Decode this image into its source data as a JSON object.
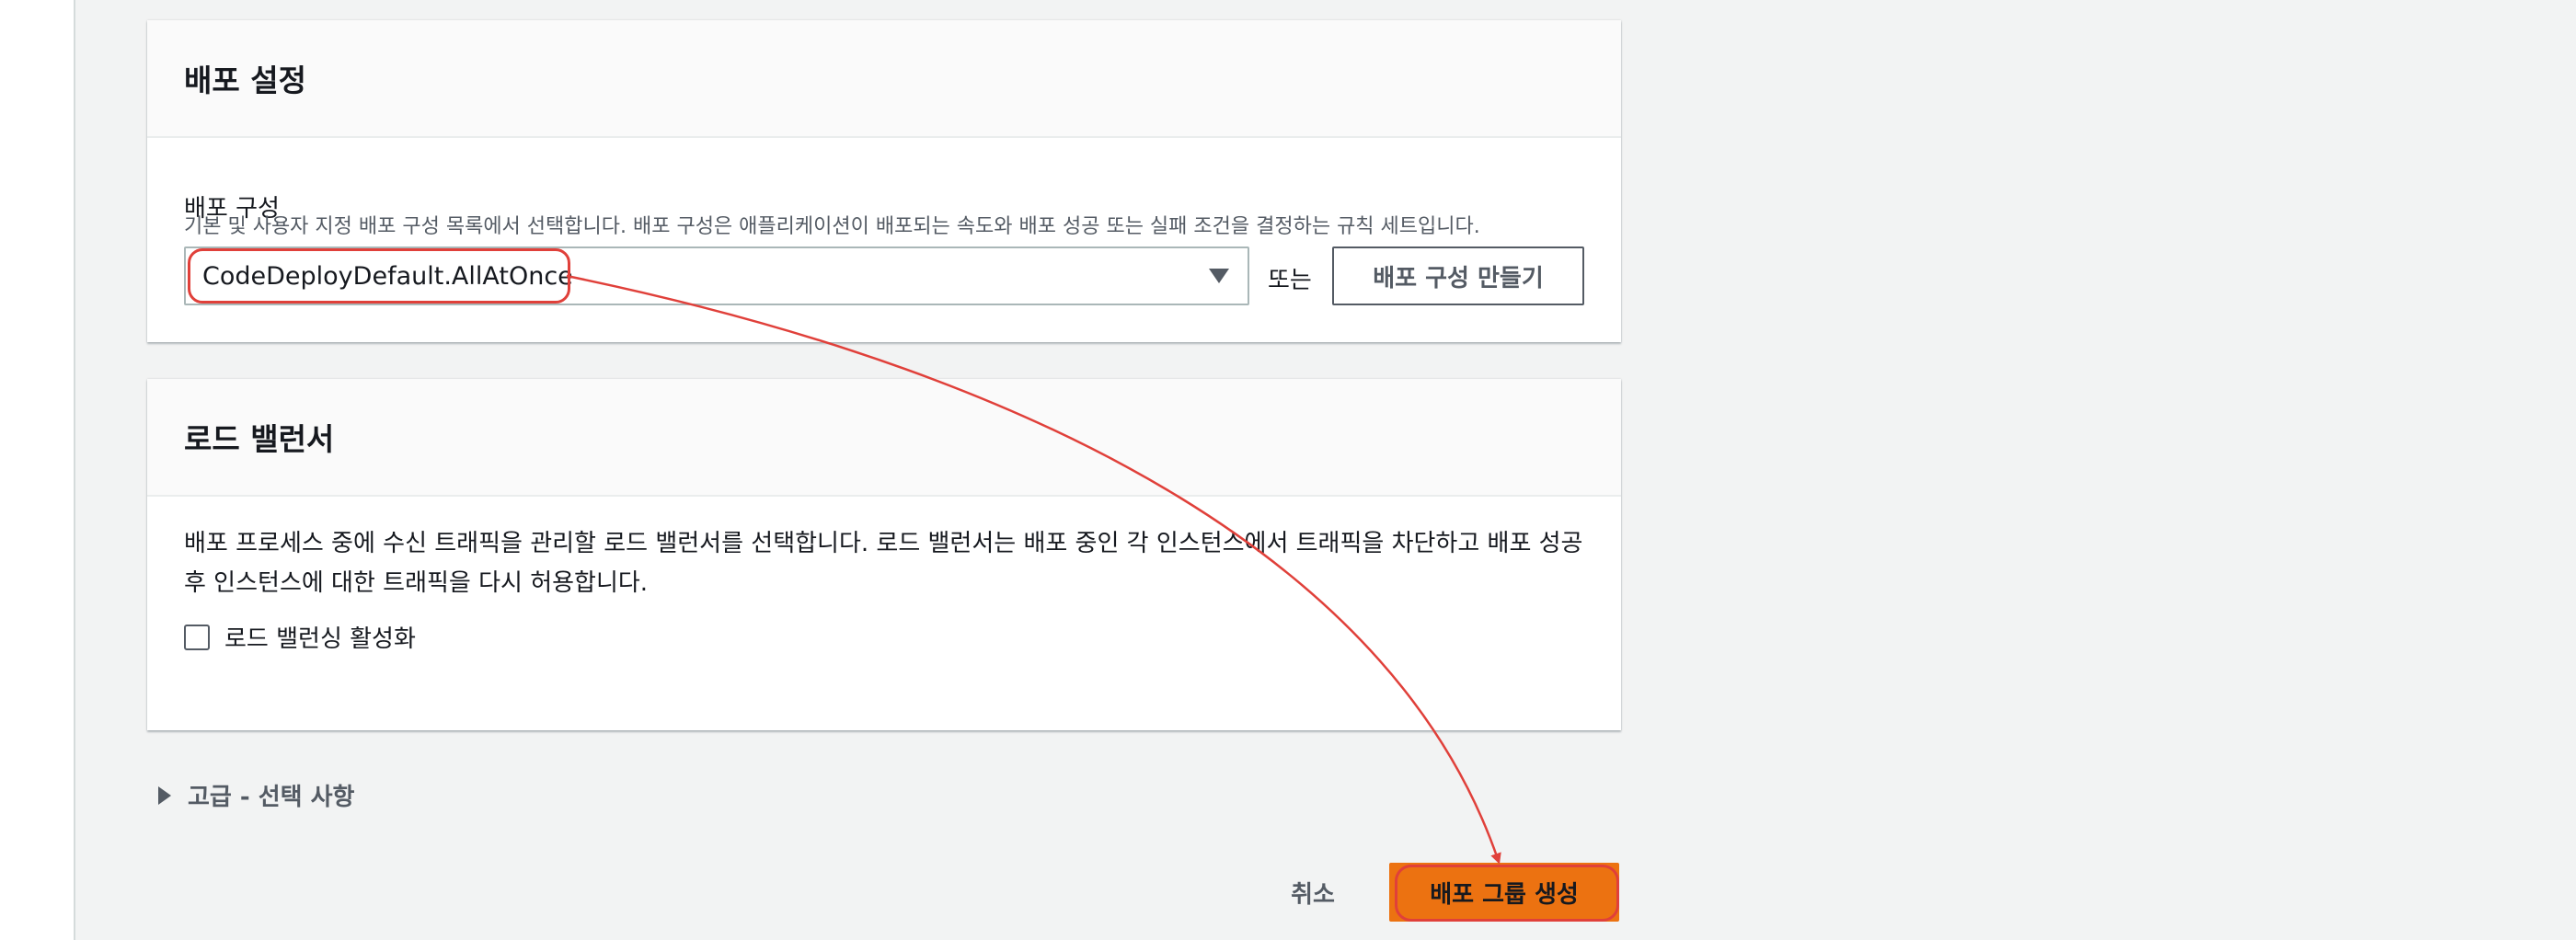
{
  "deploy_settings": {
    "title": "배포 설정",
    "config_label": "배포 구성",
    "config_description": "기본 및 사용자 지정 배포 구성 목록에서 선택합니다. 배포 구성은 애플리케이션이 배포되는 속도와 배포 성공 또는 실패 조건을 결정하는 규칙 세트입니다.",
    "selected_config": "CodeDeployDefault.AllAtOnce",
    "or_text": "또는",
    "create_config_button": "배포 구성 만들기"
  },
  "load_balancer": {
    "title": "로드 밸런서",
    "description": "배포 프로세스 중에 수신 트래픽을 관리할 로드 밸런서를 선택합니다. 로드 밸런서는 배포 중인 각 인스턴스에서 트래픽을 차단하고 배포 성공 후 인스턴스에 대한 트래픽을 다시 허용합니다.",
    "enable_checkbox_label": "로드 밸런싱 활성화",
    "enable_checked": false
  },
  "advanced": {
    "label": "고급 - 선택 사항"
  },
  "footer": {
    "cancel_button": "취소",
    "create_group_button": "배포 그룹 생성"
  },
  "colors": {
    "primary": "#ec7211",
    "annotation": "#e0403a",
    "page_background": "#f2f3f3"
  }
}
